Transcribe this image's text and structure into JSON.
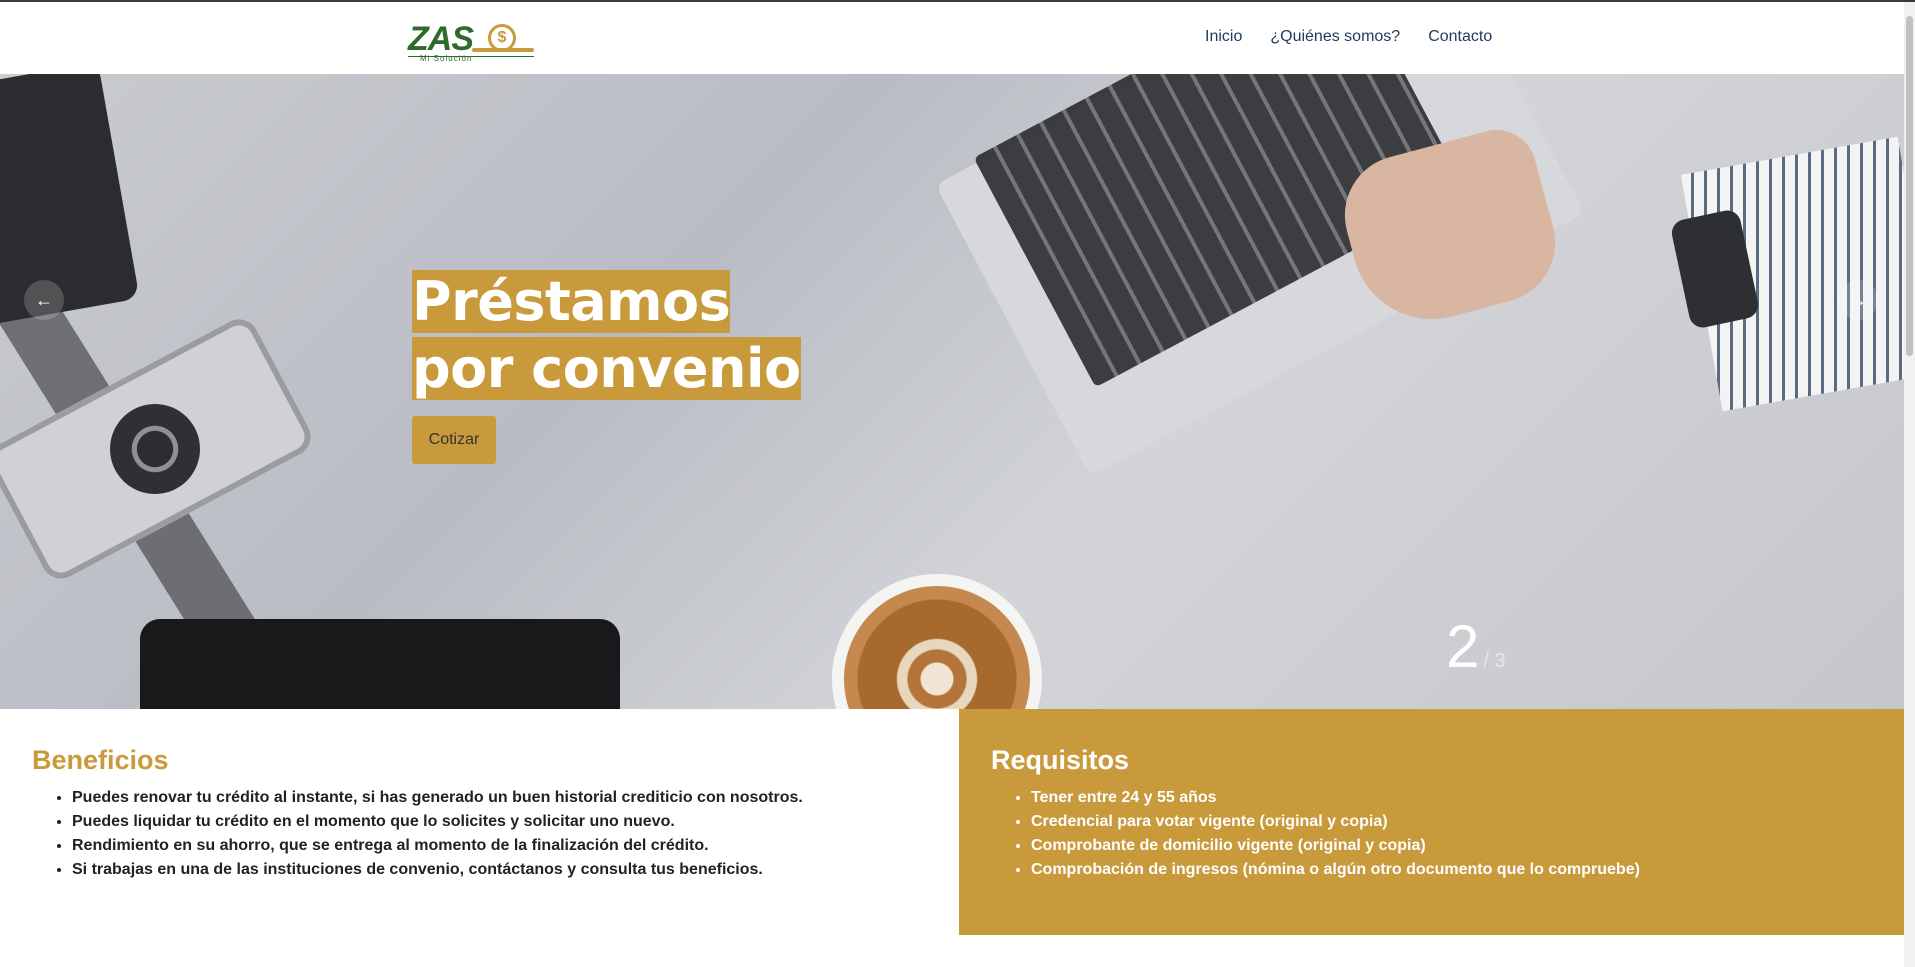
{
  "header": {
    "logo_text": "ZAS",
    "logo_sub": "Mi Solución",
    "logo_coin": "$",
    "nav": [
      {
        "label": "Inicio"
      },
      {
        "label": "¿Quiénes somos?"
      },
      {
        "label": "Contacto"
      }
    ]
  },
  "hero": {
    "title": "Préstamos por convenio",
    "cta_label": "Cotizar",
    "prev_icon": "←",
    "next_icon": "→",
    "slide_current": "2",
    "slide_total": "/ 3"
  },
  "benefits": {
    "title": "Beneficios",
    "items": [
      "Puedes renovar tu crédito al instante, si has generado un buen historial crediticio con nosotros.",
      "Puedes liquidar tu crédito en el momento que lo solicites y solicitar uno nuevo.",
      "Rendimiento en su ahorro, que se entrega al momento de la finalización del crédito.",
      "Si trabajas en una de las instituciones de convenio, contáctanos y consulta tus beneficios."
    ]
  },
  "requirements": {
    "title": "Requisitos",
    "items": [
      "Tener entre 24 y 55 años",
      "Credencial para votar vigente (original y copia)",
      "Comprobante de domicilio vigente (original y copia)",
      "Comprobación de ingresos (nómina o algún otro documento que lo compruebe)"
    ]
  },
  "colors": {
    "accent": "#c99a3b",
    "brand_green": "#2e6b2a",
    "nav_text": "#1d3a5a"
  },
  "icons": {
    "prev": "arrow-left-icon",
    "next": "arrow-right-icon"
  }
}
